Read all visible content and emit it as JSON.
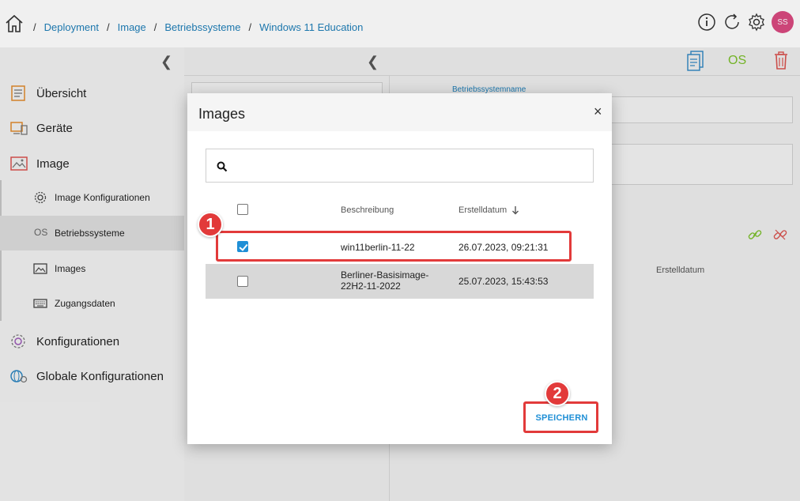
{
  "breadcrumb": {
    "sep": "/",
    "items": [
      "Deployment",
      "Image",
      "Betriebssysteme",
      "Windows 11 Education"
    ]
  },
  "header": {
    "avatar_initials": "SS"
  },
  "sidebar": {
    "items": [
      {
        "label": "Übersicht",
        "icon": "overview-icon"
      },
      {
        "label": "Geräte",
        "icon": "devices-icon"
      },
      {
        "label": "Image",
        "icon": "image-icon"
      }
    ],
    "sub_items": [
      {
        "label": "Image Konfigurationen",
        "icon": "gears-icon"
      },
      {
        "label": "Betriebssysteme",
        "icon": "os-icon",
        "prefix": "OS"
      },
      {
        "label": "Images",
        "icon": "images-icon"
      },
      {
        "label": "Zugangsdaten",
        "icon": "keyboard-icon"
      }
    ],
    "bottom_items": [
      {
        "label": "Konfigurationen",
        "icon": "config-icon"
      },
      {
        "label": "Globale Konfigurationen",
        "icon": "global-config-icon"
      }
    ]
  },
  "toolbar": {
    "os_label": "OS"
  },
  "form": {
    "name_label": "Betriebssystemname",
    "right_column_header": "Erstelldatum"
  },
  "modal": {
    "title": "Images",
    "close": "×",
    "search_placeholder": "",
    "columns": {
      "description": "Beschreibung",
      "created": "Erstelldatum"
    },
    "rows": [
      {
        "description": "win11berlin-11-22",
        "created": "26.07.2023, 09:21:31",
        "checked": true
      },
      {
        "description_line1": "Berliner-Basisimage-",
        "description_line2": "22H2-11-2022",
        "created": "25.07.2023, 15:43:53",
        "checked": false
      }
    ],
    "save_label": "SPEICHERN"
  },
  "markers": [
    "1",
    "2"
  ],
  "colors": {
    "accent": "#1f8fd6",
    "link": "#1f7fb8",
    "highlight": "#e23a3a",
    "avatar": "#d94a80",
    "os_green": "#7bbf2a"
  }
}
